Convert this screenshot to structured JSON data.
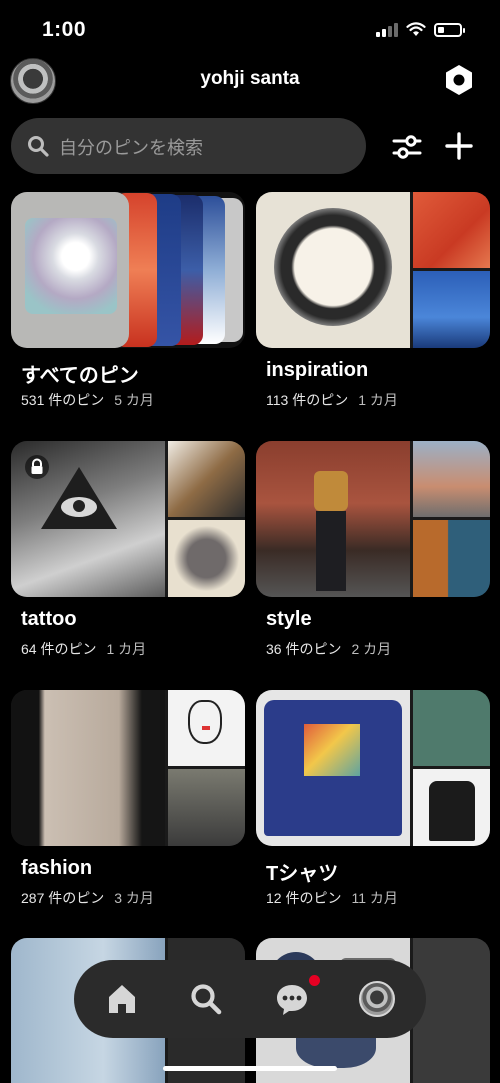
{
  "status_bar": {
    "time": "1:00",
    "battery_level": 0.25
  },
  "header": {
    "username": "yohji santa",
    "settings_icon": "hexagon-settings-icon"
  },
  "search": {
    "placeholder": "自分のピンを検索",
    "icon": "search-icon"
  },
  "toolbar": {
    "filter_icon": "sliders-icon",
    "add_icon": "plus-icon"
  },
  "boards": [
    {
      "title": "すべてのピン",
      "count": "531 件のピン",
      "age": "5 カ月",
      "locked": false
    },
    {
      "title": "inspiration",
      "count": "113 件のピン",
      "age": "1 カ月",
      "locked": false
    },
    {
      "title": "tattoo",
      "count": "64 件のピン",
      "age": "1 カ月",
      "locked": true
    },
    {
      "title": "style",
      "count": "36 件のピン",
      "age": "2 カ月",
      "locked": false
    },
    {
      "title": "fashion",
      "count": "287 件のピン",
      "age": "3 カ月",
      "locked": false
    },
    {
      "title": "Tシャツ",
      "count": "12 件のピン",
      "age": "11 カ月",
      "locked": false
    }
  ],
  "bottom_nav": {
    "items": [
      "home-icon",
      "search-icon",
      "messages-icon",
      "profile-avatar"
    ],
    "notification_color": "#e60023"
  },
  "colors": {
    "background": "#000000",
    "surface": "#333333",
    "accent": "#e60023"
  }
}
